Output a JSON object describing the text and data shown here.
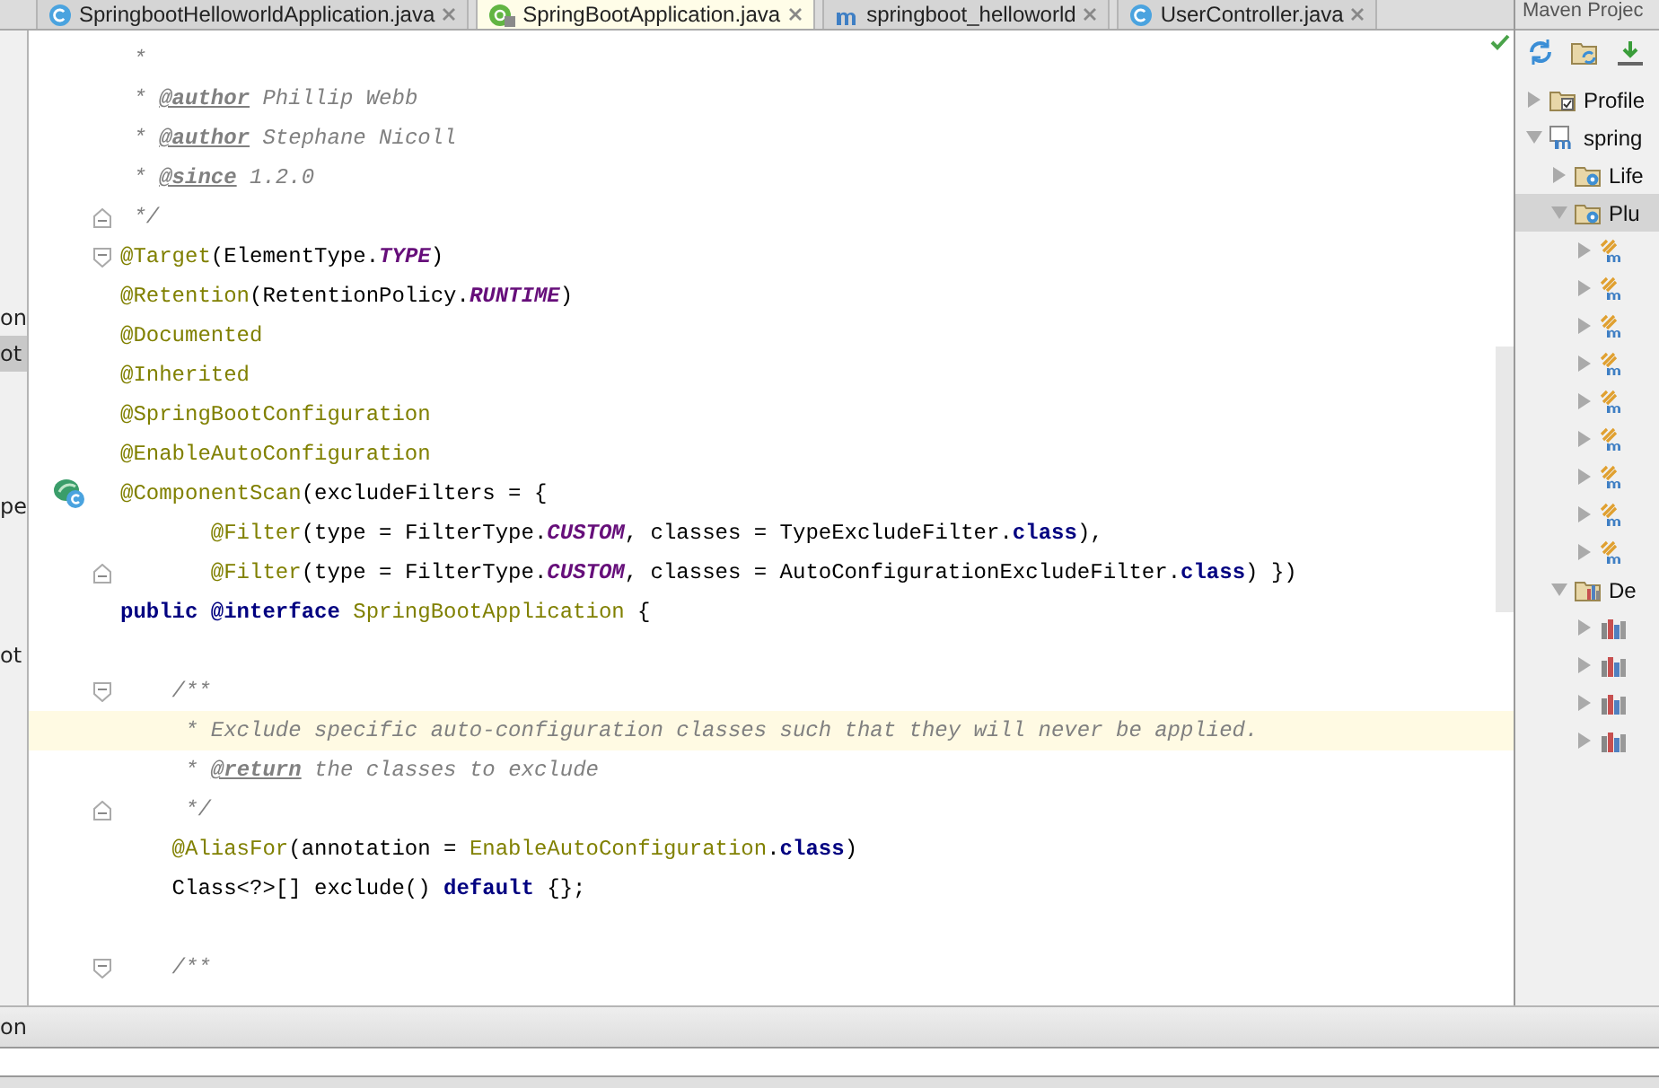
{
  "editor_tabs": [
    {
      "label": "SpringbootHelloworldApplication.java",
      "kind": "class",
      "selected": false
    },
    {
      "label": "SpringBootApplication.java",
      "kind": "annotation",
      "selected": true
    },
    {
      "label": "springboot_helloworld",
      "kind": "maven",
      "selected": false
    },
    {
      "label": "UserController.java",
      "kind": "class",
      "selected": false
    }
  ],
  "left_strip": [
    {
      "text": "on",
      "selected": false
    },
    {
      "text": "ot",
      "selected": true
    },
    {
      "text": "pe",
      "selected": false
    },
    {
      "text": "ot",
      "selected": false
    }
  ],
  "code": {
    "lines": [
      {
        "kind": "plain",
        "tokens": [
          {
            "kind": "comment",
            "text": " *"
          }
        ],
        "highlighted": false
      },
      {
        "kind": "plain",
        "tokens": [
          {
            "kind": "comment",
            "text": " * "
          },
          {
            "kind": "doctag",
            "text": "@author"
          },
          {
            "kind": "comment",
            "text": " Phillip Webb"
          }
        ],
        "highlighted": false
      },
      {
        "kind": "plain",
        "tokens": [
          {
            "kind": "comment",
            "text": " * "
          },
          {
            "kind": "doctag",
            "text": "@author"
          },
          {
            "kind": "comment",
            "text": " Stephane Nicoll"
          }
        ],
        "highlighted": false
      },
      {
        "kind": "plain",
        "tokens": [
          {
            "kind": "comment",
            "text": " * "
          },
          {
            "kind": "doctag",
            "text": "@since"
          },
          {
            "kind": "comment",
            "text": " 1.2.0"
          }
        ],
        "highlighted": false
      },
      {
        "kind": "fold_end",
        "tokens": [
          {
            "kind": "comment",
            "text": " */"
          }
        ],
        "highlighted": false
      },
      {
        "kind": "fold_start",
        "tokens": [
          {
            "kind": "annotation",
            "text": "@Target"
          },
          {
            "kind": "plain",
            "text": "(ElementType."
          },
          {
            "kind": "constant",
            "text": "TYPE"
          },
          {
            "kind": "plain",
            "text": ")"
          }
        ],
        "highlighted": false
      },
      {
        "kind": "plain",
        "tokens": [
          {
            "kind": "annotation",
            "text": "@Retention"
          },
          {
            "kind": "plain",
            "text": "(RetentionPolicy."
          },
          {
            "kind": "constant",
            "text": "RUNTIME"
          },
          {
            "kind": "plain",
            "text": ")"
          }
        ],
        "highlighted": false
      },
      {
        "kind": "plain",
        "tokens": [
          {
            "kind": "annotation",
            "text": "@Documented"
          }
        ],
        "highlighted": false
      },
      {
        "kind": "plain",
        "tokens": [
          {
            "kind": "annotation",
            "text": "@Inherited"
          }
        ],
        "highlighted": false
      },
      {
        "kind": "plain",
        "tokens": [
          {
            "kind": "annotation",
            "text": "@SpringBootConfiguration"
          }
        ],
        "highlighted": false
      },
      {
        "kind": "plain",
        "tokens": [
          {
            "kind": "annotation",
            "text": "@EnableAutoConfiguration"
          }
        ],
        "highlighted": false
      },
      {
        "kind": "bean",
        "tokens": [
          {
            "kind": "annotation",
            "text": "@ComponentScan"
          },
          {
            "kind": "plain",
            "text": "(excludeFilters = {"
          }
        ],
        "highlighted": false
      },
      {
        "kind": "plain",
        "tokens": [
          {
            "kind": "annotation",
            "text": "       @Filter"
          },
          {
            "kind": "plain",
            "text": "(type = FilterType."
          },
          {
            "kind": "constant",
            "text": "CUSTOM"
          },
          {
            "kind": "plain",
            "text": ", classes = TypeExcludeFilter."
          },
          {
            "kind": "keyword",
            "text": "class"
          },
          {
            "kind": "plain",
            "text": "),"
          }
        ],
        "highlighted": false
      },
      {
        "kind": "fold_end",
        "tokens": [
          {
            "kind": "annotation",
            "text": "       @Filter"
          },
          {
            "kind": "plain",
            "text": "(type = FilterType."
          },
          {
            "kind": "constant",
            "text": "CUSTOM"
          },
          {
            "kind": "plain",
            "text": ", classes = AutoConfigurationExcludeFilter."
          },
          {
            "kind": "keyword",
            "text": "class"
          },
          {
            "kind": "plain",
            "text": ") })"
          }
        ],
        "highlighted": false
      },
      {
        "kind": "plain",
        "tokens": [
          {
            "kind": "keyword",
            "text": "public @interface"
          },
          {
            "kind": "type",
            "text": " SpringBootApplication"
          },
          {
            "kind": "plain",
            "text": " {"
          }
        ],
        "highlighted": false
      },
      {
        "kind": "plain",
        "highlighted": false
      },
      {
        "kind": "fold_start",
        "tokens": [
          {
            "kind": "comment",
            "text": "    /**"
          }
        ],
        "highlighted": false
      },
      {
        "kind": "plain",
        "tokens": [
          {
            "kind": "comment",
            "text": "     * Exclude specific auto-configuration classes such that they will never be applied."
          }
        ],
        "highlighted": true
      },
      {
        "kind": "plain",
        "tokens": [
          {
            "kind": "comment",
            "text": "     * "
          },
          {
            "kind": "doctag",
            "text": "@return"
          },
          {
            "kind": "comment",
            "text": " the classes to exclude"
          }
        ],
        "highlighted": false
      },
      {
        "kind": "fold_end",
        "tokens": [
          {
            "kind": "comment",
            "text": "     */"
          }
        ],
        "highlighted": false
      },
      {
        "kind": "plain",
        "tokens": [
          {
            "kind": "annotation",
            "text": "    @AliasFor"
          },
          {
            "kind": "plain",
            "text": "(annotation = "
          },
          {
            "kind": "type",
            "text": "EnableAutoConfiguration"
          },
          {
            "kind": "plain",
            "text": "."
          },
          {
            "kind": "keyword",
            "text": "class"
          },
          {
            "kind": "plain",
            "text": ")"
          }
        ],
        "highlighted": false
      },
      {
        "kind": "plain",
        "tokens": [
          {
            "kind": "plain",
            "text": "    Class<?>[] exclude() "
          },
          {
            "kind": "keyword",
            "text": "default"
          },
          {
            "kind": "plain",
            "text": " {};"
          }
        ],
        "highlighted": false
      },
      {
        "kind": "plain",
        "highlighted": false
      },
      {
        "kind": "fold_start",
        "tokens": [
          {
            "kind": "comment",
            "text": "    /**"
          }
        ],
        "highlighted": false
      }
    ]
  },
  "maven_panel": {
    "title": "Maven Projec",
    "tree": [
      {
        "label": "Profile",
        "kind": "profiles",
        "expanded": false,
        "selected": false
      },
      {
        "label": "spring",
        "kind": "project",
        "expanded": true,
        "selected": false,
        "children": [
          {
            "label": "Life",
            "kind": "lifecycle",
            "expanded": false,
            "selected": false
          },
          {
            "label": "Plu",
            "kind": "plugins",
            "expanded": true,
            "selected": true,
            "children": [
              {
                "kind": "plugin",
                "expanded": false,
                "selected": false
              },
              {
                "kind": "plugin",
                "expanded": false,
                "selected": false
              },
              {
                "kind": "plugin",
                "expanded": false,
                "selected": false
              },
              {
                "kind": "plugin",
                "expanded": false,
                "selected": false
              },
              {
                "kind": "plugin",
                "expanded": false,
                "selected": false
              },
              {
                "kind": "plugin",
                "expanded": false,
                "selected": false
              },
              {
                "kind": "plugin",
                "expanded": false,
                "selected": false
              },
              {
                "kind": "plugin",
                "expanded": false,
                "selected": false
              },
              {
                "kind": "plugin",
                "expanded": false,
                "selected": false
              }
            ]
          },
          {
            "label": "De",
            "kind": "dependencies",
            "expanded": true,
            "selected": false,
            "children": [
              {
                "kind": "dependency",
                "expanded": false,
                "selected": false
              },
              {
                "kind": "dependency",
                "expanded": false,
                "selected": false
              },
              {
                "kind": "dependency",
                "expanded": false,
                "selected": false
              },
              {
                "kind": "dependency",
                "expanded": false,
                "selected": false
              }
            ]
          }
        ]
      }
    ]
  },
  "bottom_bar": {
    "text": "on"
  }
}
